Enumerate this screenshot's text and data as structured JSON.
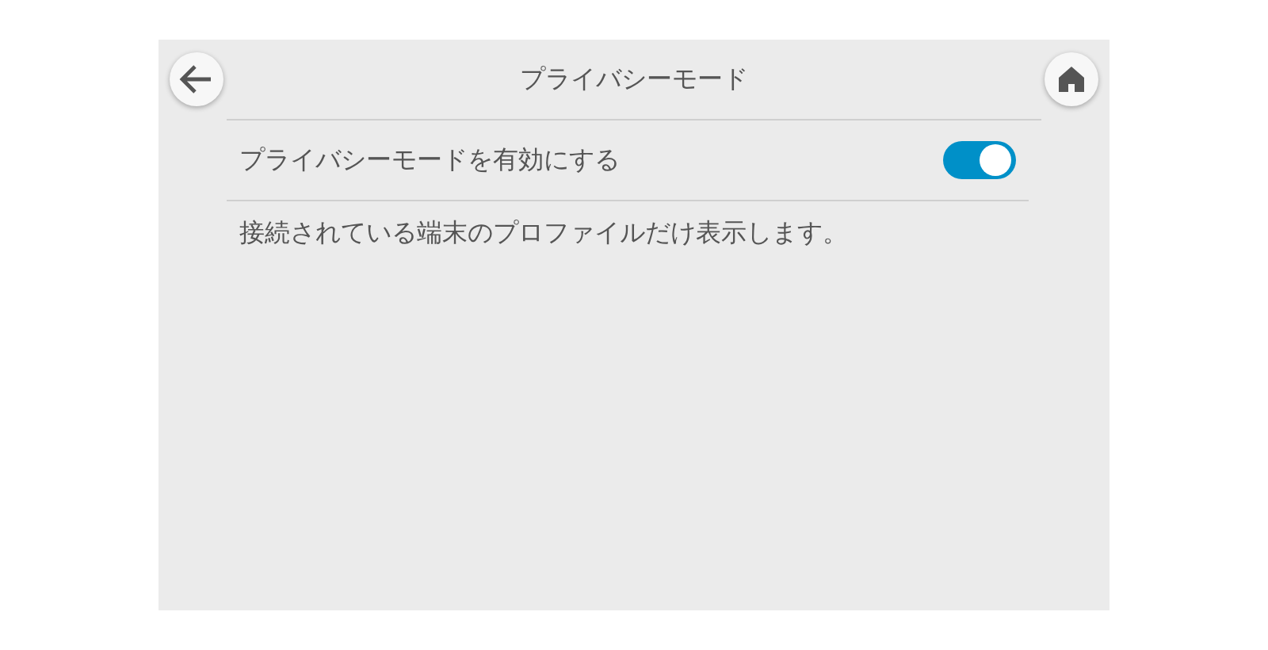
{
  "header": {
    "title": "プライバシーモード"
  },
  "setting": {
    "label": "プライバシーモードを有効にする",
    "on": true
  },
  "description": "接続されている端末のプロファイルだけ表示します。"
}
